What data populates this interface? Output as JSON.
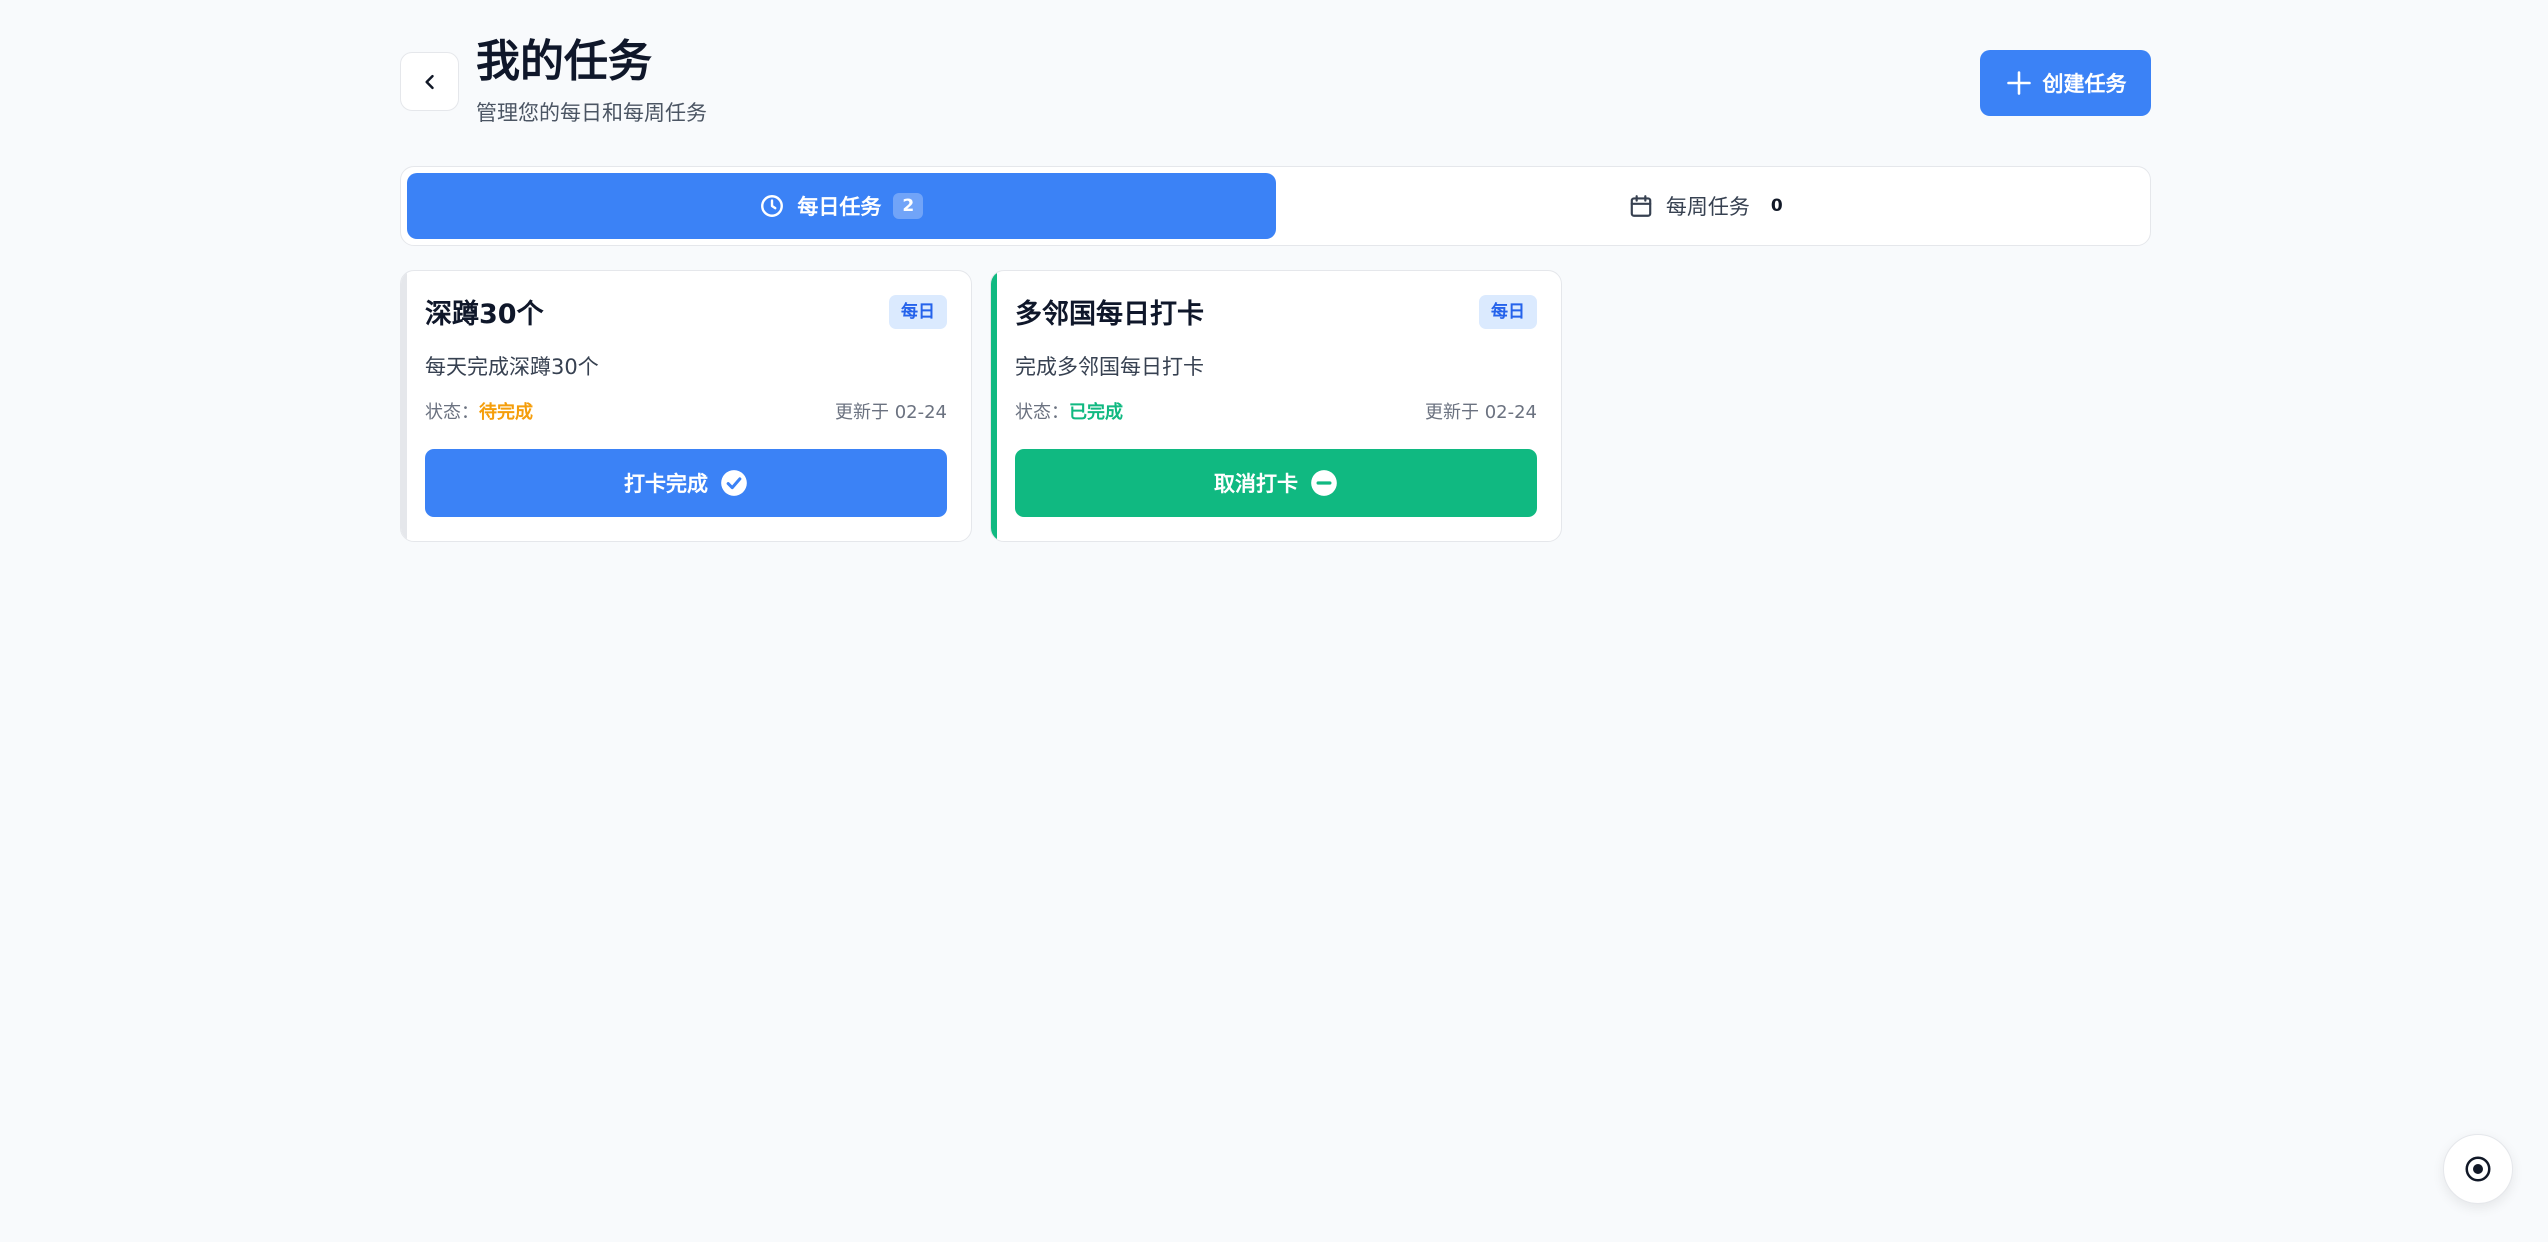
{
  "header": {
    "title": "我的任务",
    "subtitle": "管理您的每日和每周任务",
    "create_label": "创建任务"
  },
  "tabs": [
    {
      "label": "每日任务",
      "count": "2",
      "icon": "clock-icon",
      "active": true
    },
    {
      "label": "每周任务",
      "count": "0",
      "icon": "calendar-icon",
      "active": false
    }
  ],
  "tasks": [
    {
      "title": "深蹲30个",
      "badge": "每日",
      "description": "每天完成深蹲30个",
      "status_label": "状态：",
      "status_value": "待完成",
      "status_color": "#f59e0b",
      "updated": "更新于 02-24",
      "action_label": "打卡完成",
      "action_icon": "check-circle-icon",
      "action_color": "#3b82f6",
      "accent_color": "#e5e7eb"
    },
    {
      "title": "多邻国每日打卡",
      "badge": "每日",
      "description": "完成多邻国每日打卡",
      "status_label": "状态：",
      "status_value": "已完成",
      "status_color": "#10b981",
      "updated": "更新于 02-24",
      "action_label": "取消打卡",
      "action_icon": "minus-circle-icon",
      "action_color": "#10b981",
      "accent_color": "#10b981"
    }
  ],
  "colors": {
    "primary": "#3b82f6",
    "success": "#10b981",
    "warning": "#f59e0b",
    "background": "#f8fafc"
  },
  "fab": {
    "icon": "target-icon"
  }
}
